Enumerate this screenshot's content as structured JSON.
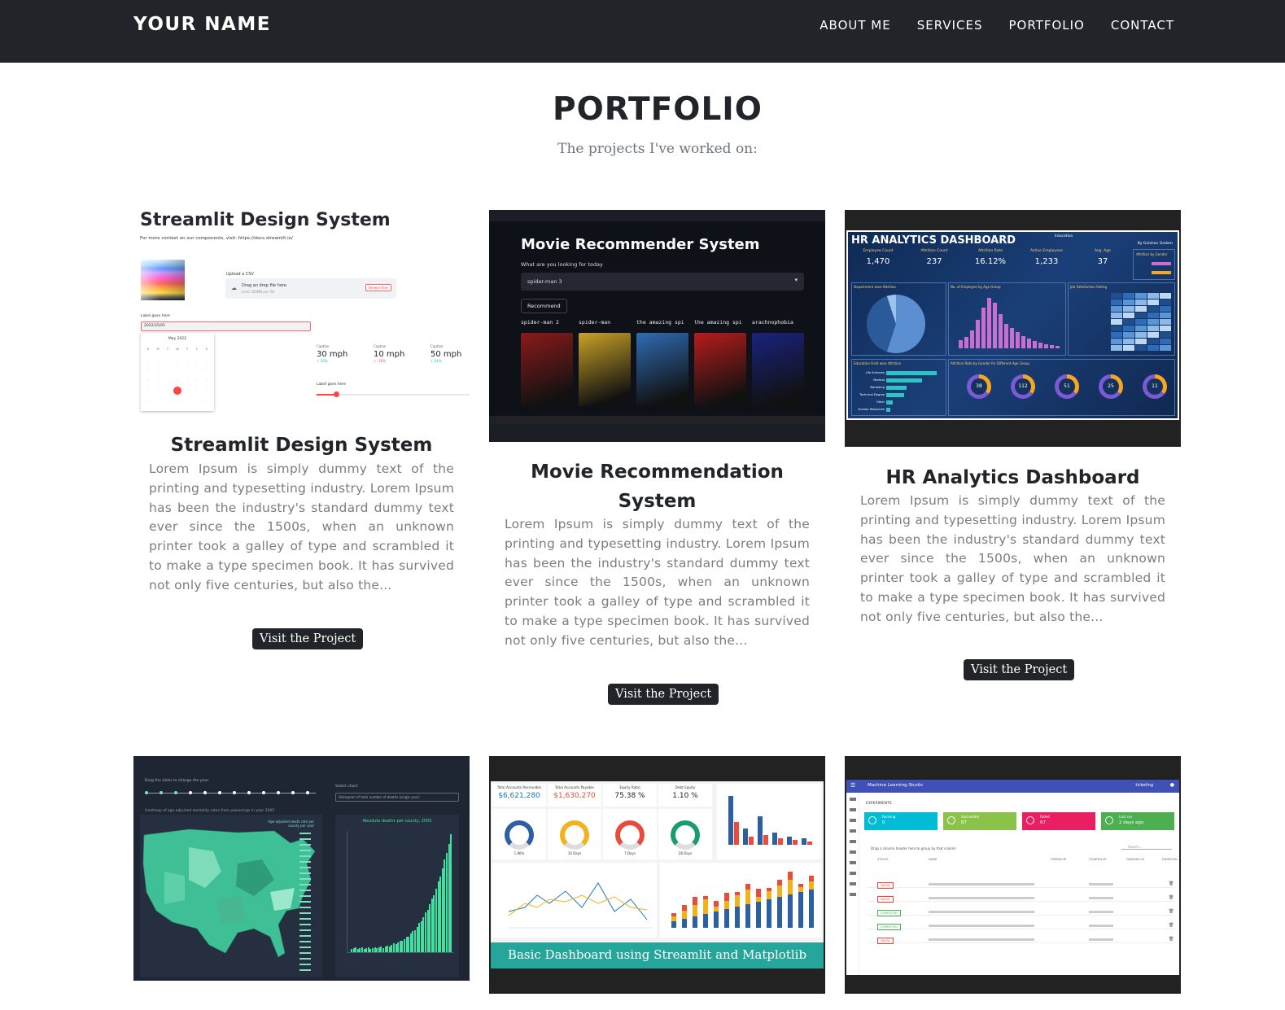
{
  "nav": {
    "brand": "YOUR NAME",
    "links": [
      "ABOUT ME",
      "SERVICES",
      "PORTFOLIO",
      "CONTACT"
    ]
  },
  "section": {
    "title": "PORTFOLIO",
    "subtitle": "The projects I've worked on:"
  },
  "projects": [
    {
      "title": "Streamlit Design System",
      "text": "Lorem Ipsum is simply dummy text of the printing and typesetting industry. Lorem Ipsum has been the industry's standard dummy text ever since the 1500s, when an unknown printer took a galley of type and scrambled it to make a type specimen book. It has survived not only five centuries, but also the...",
      "button": "Visit the Project",
      "thumb": {
        "heading": "Streamlit Design System",
        "context": "For more context on our components, visit: https://docs.streamlit.io/",
        "upload_label": "Upload a CSV",
        "upload_text": "Drag an drop file here",
        "upload_limit": "Limit 200MB per file",
        "browse": "Browse files",
        "date_label": "Label goes here",
        "date_value": "2022/25/05",
        "month": "May 2022",
        "weekdays": [
          "S",
          "M",
          "T",
          "W",
          "T",
          "F",
          "S"
        ],
        "caption": "Caption",
        "metrics": [
          "30 mph",
          "10 mph",
          "50 mph"
        ],
        "deltas": [
          "↑ 10%",
          "↓ -10%",
          "↑ 24%"
        ],
        "slider_label": "Label goes here"
      }
    },
    {
      "title": "Movie Recommendation System",
      "text": "Lorem Ipsum is simply dummy text of the printing and typesetting industry. Lorem Ipsum has been the industry's standard dummy text ever since the 1500s, when an unknown printer took a galley of type and scrambled it to make a type specimen book. It has survived not only five centuries, but also the...",
      "button": "Visit the Project",
      "thumb": {
        "heading": "Movie Recommender System",
        "question": "What are you looking for today",
        "select": "spider-man 3",
        "recommend": "Recommend",
        "movies": [
          "spider-man 2",
          "spider-man",
          "the amazing spi",
          "the amazing spi",
          "arachnophobia"
        ]
      }
    },
    {
      "title": "HR Analytics Dashboard",
      "text": "Lorem Ipsum is simply dummy text of the printing and typesetting industry. Lorem Ipsum has been the industry's standard dummy text ever since the 1500s, when an unknown printer took a galley of type and scrambled it to make a type specimen book. It has survived not only five centuries, but also the...",
      "button": "Visit the Project",
      "thumb": {
        "heading": "HR ANALYTICS DASHBOARD",
        "filter": "Education",
        "author": "By Gulshan Gedam",
        "kpis": [
          {
            "label": "Employee Count",
            "value": "1,470"
          },
          {
            "label": "Attrition Count",
            "value": "237"
          },
          {
            "label": "Attrition Rate",
            "value": "16.12%"
          },
          {
            "label": "Active Employees",
            "value": "1,233"
          },
          {
            "label": "Avg. Age",
            "value": "37"
          }
        ],
        "gender_label": "Attrition by Gender",
        "panels": [
          "Department wise Attrition",
          "No. of Employee by Age Group",
          "Job Satisfaction Rating",
          "Education Field wise Attrition",
          "Attrition Rate by Gender for Different Age Group"
        ],
        "donuts": [
          "38",
          "112",
          "51",
          "25",
          "11"
        ],
        "edu_bars": [
          {
            "label": "Life Sciences",
            "value": "89"
          },
          {
            "label": "Medical",
            "value": "63"
          },
          {
            "label": "Marketing",
            "value": "35"
          },
          {
            "label": "Technical Degree",
            "value": "32"
          },
          {
            "label": "Other",
            "value": "11"
          },
          {
            "label": "Human Resources",
            "value": "7"
          }
        ]
      }
    },
    {
      "title": "",
      "thumb": {
        "slider_caption": "Drag the slider to change the year:",
        "select_caption": "Select chart:",
        "select_value": "Histogram of total number of deaths (single year)",
        "map_title": "Heatmap of age adjusted mortality rates from poisonings in year 2005",
        "map_legend": "Age-adjusted death rate per county per year",
        "bar_title": "Absolute deaths per county, 2005"
      }
    },
    {
      "title": "",
      "thumb": {
        "kpis": [
          {
            "label": "Total Accounts Receivable",
            "value": "$6,621,280"
          },
          {
            "label": "Total Accounts Payable",
            "value": "$1,630,270"
          },
          {
            "label": "Equity Ratio",
            "value": "75.38 %"
          },
          {
            "label": "Debt Equity",
            "value": "1.10 %"
          }
        ],
        "gauges": [
          "1.86%",
          "10 Days",
          "7 Days",
          "28 Days"
        ],
        "banner": "Basic Dashboard using Streamlit and Matplotlib"
      }
    },
    {
      "title": "",
      "thumb": {
        "app": "Machine Learning Studio",
        "user": "ticketing",
        "section": "EXPERIMENTS",
        "tiles": [
          {
            "label": "Running",
            "value": "0",
            "color": "#00bcd4"
          },
          {
            "label": "Succeeded",
            "value": "87",
            "color": "#8bc34a"
          },
          {
            "label": "Failed",
            "value": "67",
            "color": "#e91e63"
          },
          {
            "label": "Last run",
            "value": "2 days ago",
            "color": "#4caf50"
          }
        ],
        "drag_hint": "Drag a column header here to group by that column",
        "search": "Search...",
        "columns": [
          "STATUS",
          "NAME",
          "OPERATOR",
          "STARTED AT",
          "FINISHED AT",
          "DURATION"
        ],
        "rows": [
          {
            "status": "FAILED",
            "color": "#f44336"
          },
          {
            "status": "FAILED",
            "color": "#f44336"
          },
          {
            "status": "COMPLETED",
            "color": "#4caf50"
          },
          {
            "status": "COMPLETED",
            "color": "#4caf50"
          },
          {
            "status": "FAILED",
            "color": "#f44336"
          }
        ]
      }
    }
  ]
}
